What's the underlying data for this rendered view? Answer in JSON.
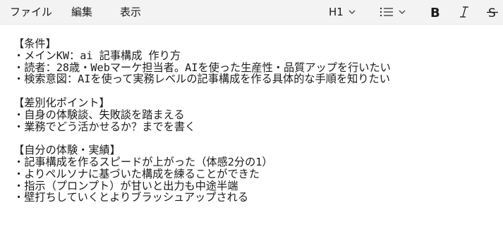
{
  "menu": {
    "file": "ファイル",
    "edit": "編集",
    "view": "表示"
  },
  "toolbar": {
    "heading_label": "H1",
    "heading_icon": "chevron-down-icon",
    "list_icon": "bulleted-list-icon",
    "bold_icon": "bold-icon",
    "italic_icon": "italic-icon",
    "strike_icon": "strikethrough-icon"
  },
  "document": {
    "lines": [
      "【条件】",
      "・メインKW：ai 記事構成 作り方",
      "・読者：28歳・Webマーケ担当者。AIを使った生産性・品質アップを行いたい",
      "・検索意図：AIを使って実務レベルの記事構成を作る具体的な手順を知りたい",
      "",
      "【差別化ポイント】",
      "・自身の体験談、失敗談を踏まえる",
      "・業務でどう活かせるか？までを書く",
      "",
      "【自分の体験・実績】",
      "・記事構成を作るスピードが上がった（体感2分の1）",
      "・よりペルソナに基づいた構成を練ることができた",
      "・指示（プロンプト）が甘いと出力も中途半端",
      "・壁打ちしていくとよりブラッシュアップされる"
    ]
  }
}
